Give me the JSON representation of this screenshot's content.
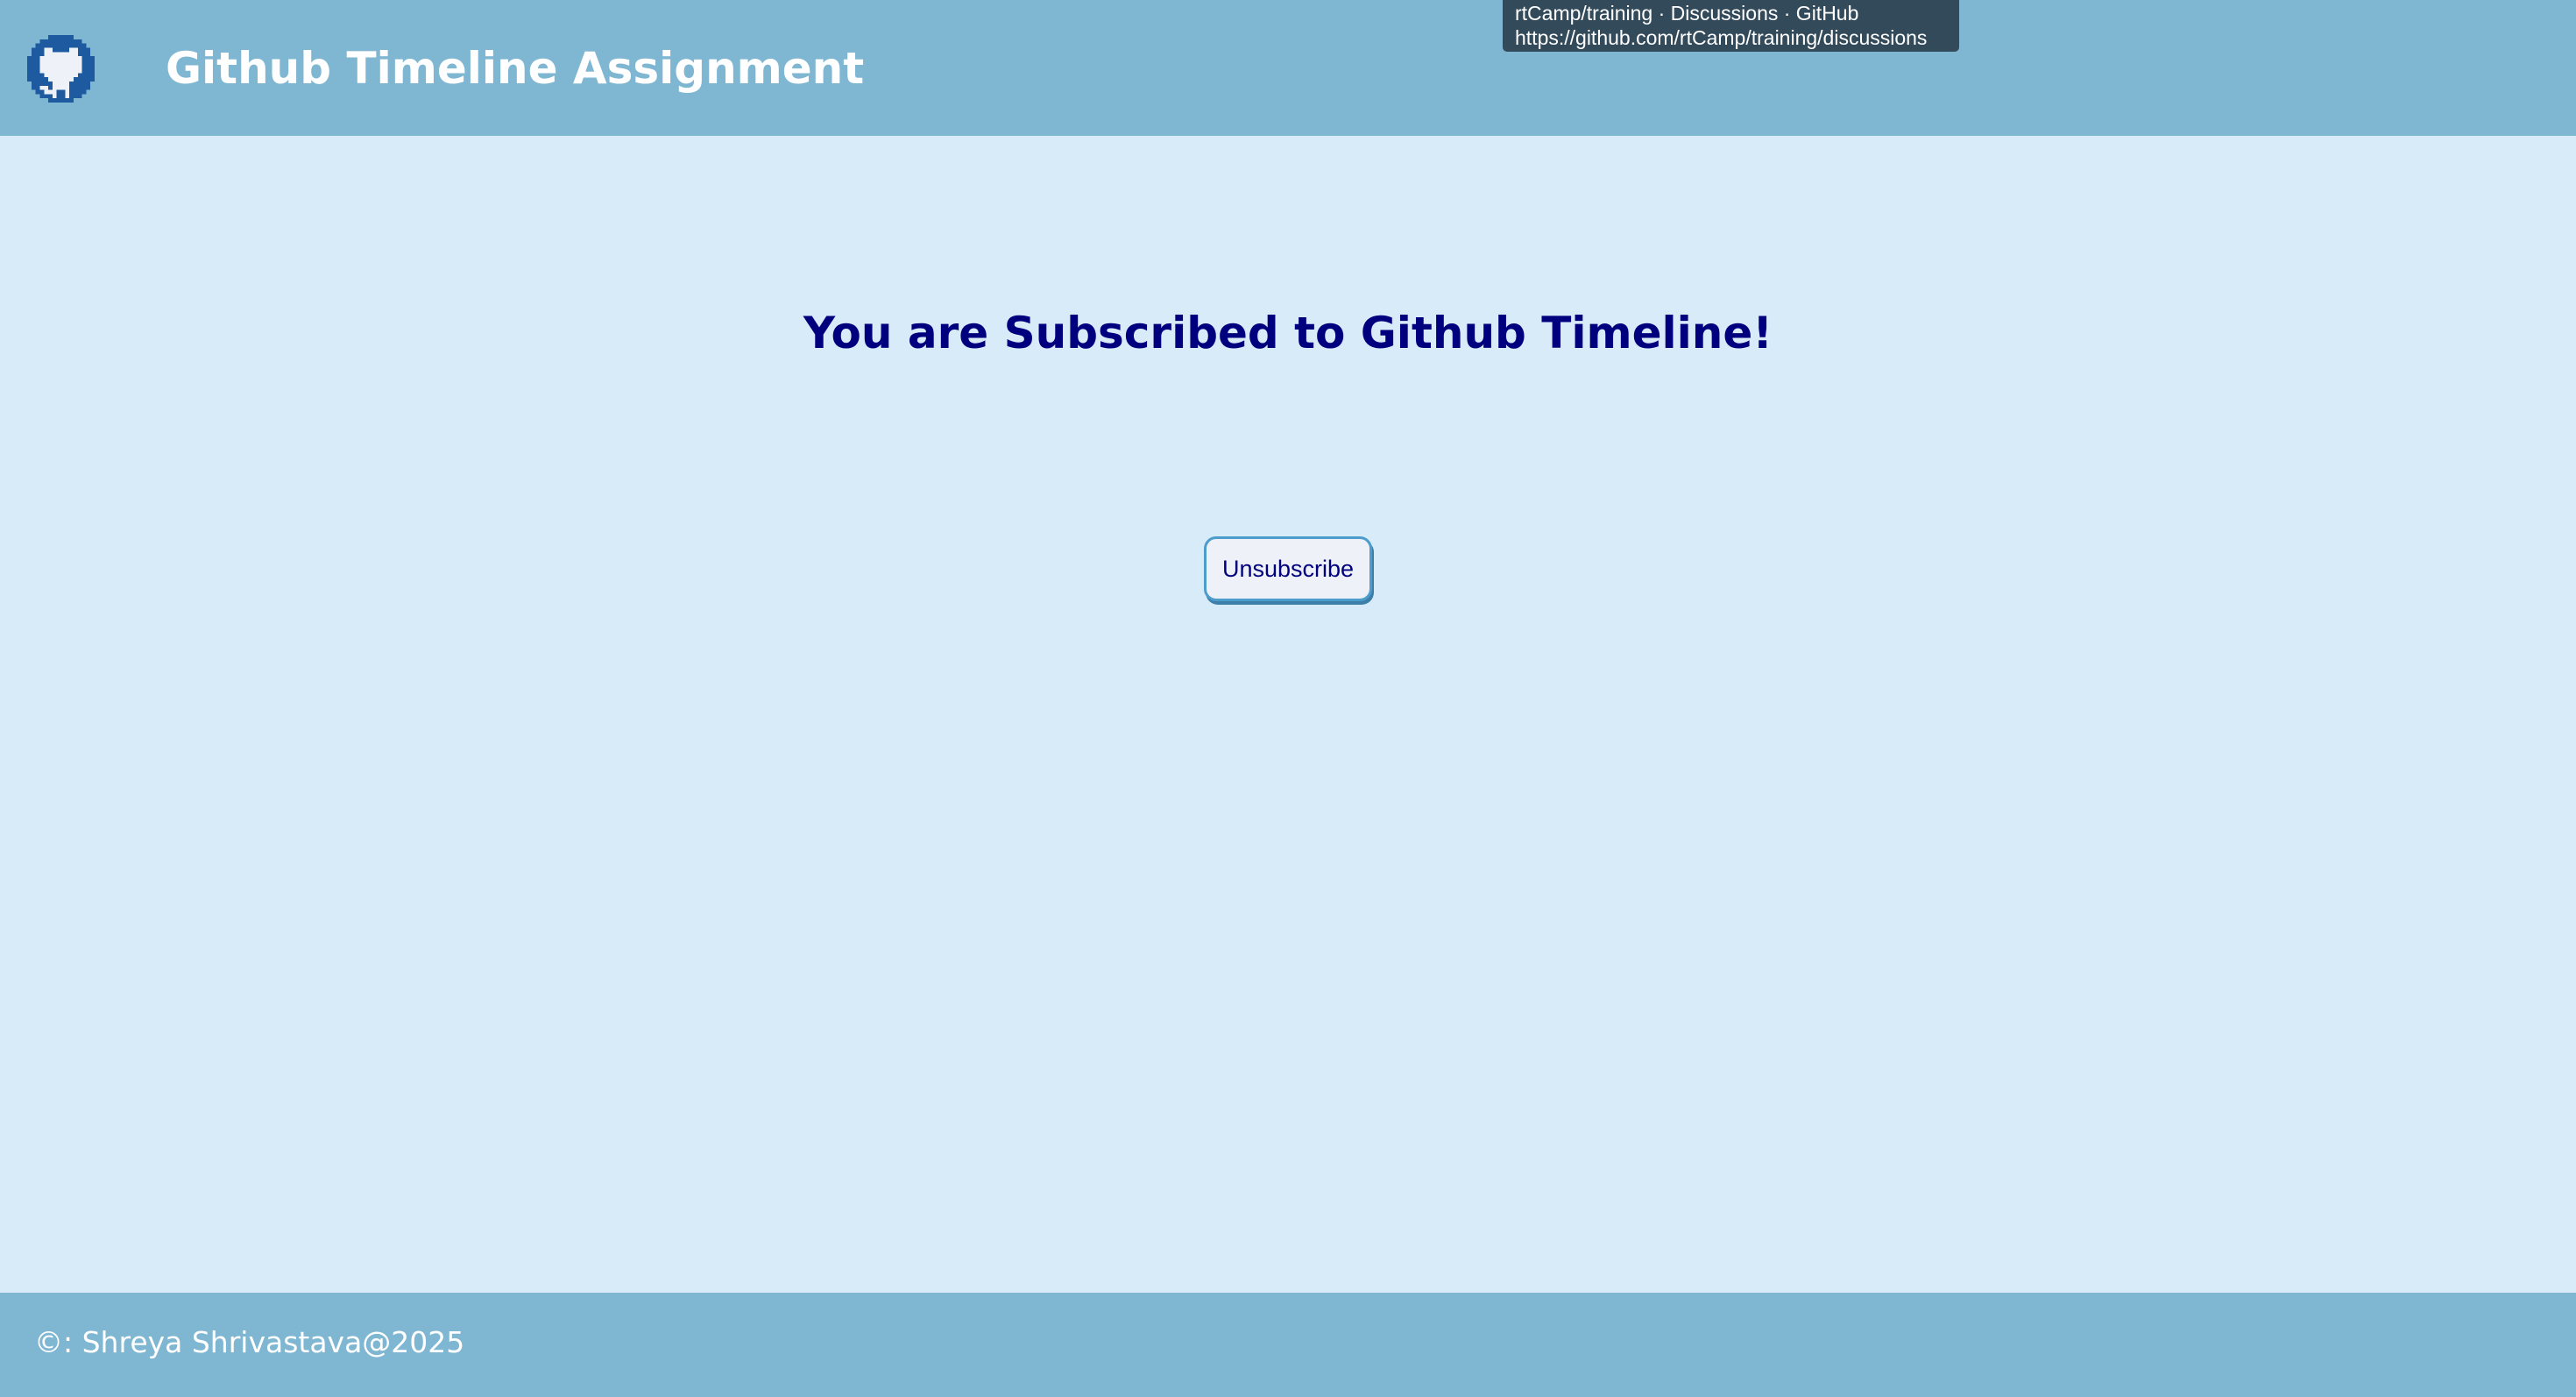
{
  "header": {
    "title": "Github Timeline Assignment",
    "logo_icon": "github-octocat-icon"
  },
  "tooltip": {
    "title": "rtCamp/training · Discussions · GitHub",
    "url": "https://github.com/rtCamp/training/discussions"
  },
  "main": {
    "heading": "You are Subscribed to Github Timeline!",
    "unsubscribe_label": "Unsubscribe"
  },
  "footer": {
    "text": "©: Shreya Shrivastava@2025"
  },
  "colors": {
    "header_bg": "#7fb7d3",
    "page_bg": "#d7ebf9",
    "heading_text": "#00007f",
    "button_border": "#4c9ccc",
    "tooltip_bg": "#334a5b",
    "logo": "#1e5aa0"
  }
}
